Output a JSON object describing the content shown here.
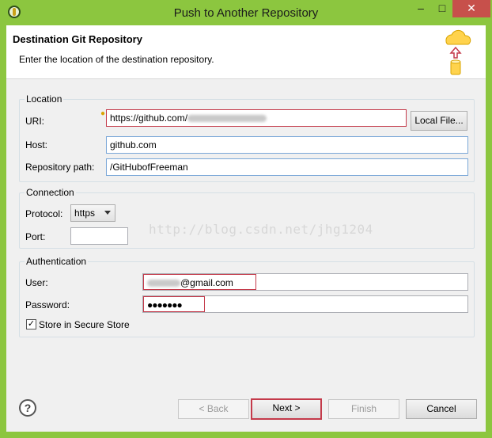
{
  "window": {
    "title": "Push to Another Repository",
    "controls": {
      "minimize": "–",
      "maximize": "□",
      "close": "✕"
    }
  },
  "banner": {
    "title": "Destination Git Repository",
    "subtitle": "Enter the location of the destination repository."
  },
  "location": {
    "legend": "Location",
    "uri_label": "URI:",
    "uri_value_visible": "https://github.com/",
    "local_file_button": "Local File...",
    "host_label": "Host:",
    "host_value": "github.com",
    "repo_path_label": "Repository path:",
    "repo_path_value": "/GitHubofFreeman"
  },
  "connection": {
    "legend": "Connection",
    "protocol_label": "Protocol:",
    "protocol_value": "https",
    "port_label": "Port:",
    "port_value": ""
  },
  "authentication": {
    "legend": "Authentication",
    "user_label": "User:",
    "user_value_visible": "@gmail.com",
    "password_label": "Password:",
    "password_value": "●●●●●●●",
    "store_label": "Store in Secure Store",
    "store_checked": true,
    "checkmark": "✓"
  },
  "watermark": "http://blog.csdn.net/jhg1204",
  "footer": {
    "help": "?",
    "back": "< Back",
    "next": "Next >",
    "finish": "Finish",
    "cancel": "Cancel"
  },
  "colors": {
    "window_frame": "#8cc63f",
    "close_button": "#c7504b",
    "highlight_border": "#c43a4a",
    "field_border": "#7aa7d8"
  }
}
